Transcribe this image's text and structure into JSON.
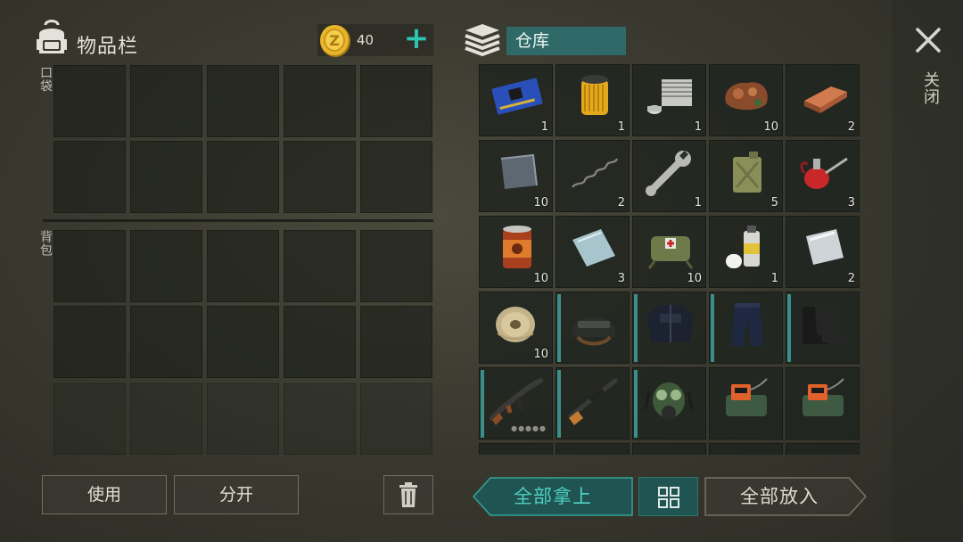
{
  "inventory": {
    "title": "物品栏",
    "pocket_label": "口袋",
    "backpack_label": "背包",
    "coins": "40"
  },
  "storage": {
    "title": "仓库",
    "close_label": "关闭",
    "items": [
      {
        "name": "circuit-board",
        "qty": "1",
        "mark": false
      },
      {
        "name": "oil-filter",
        "qty": "1",
        "mark": false
      },
      {
        "name": "engine-cylinder",
        "qty": "1",
        "mark": false
      },
      {
        "name": "copper-ore",
        "qty": "10",
        "mark": false
      },
      {
        "name": "copper-ingot",
        "qty": "2",
        "mark": false
      },
      {
        "name": "iron-plate",
        "qty": "10",
        "mark": false
      },
      {
        "name": "spring",
        "qty": "2",
        "mark": false
      },
      {
        "name": "wrench",
        "qty": "1",
        "mark": false
      },
      {
        "name": "jerry-can",
        "qty": "5",
        "mark": false
      },
      {
        "name": "oil-can",
        "qty": "3",
        "mark": false
      },
      {
        "name": "canned-food",
        "qty": "10",
        "mark": false
      },
      {
        "name": "glass-pane",
        "qty": "3",
        "mark": false
      },
      {
        "name": "first-aid-bag",
        "qty": "10",
        "mark": false
      },
      {
        "name": "spray-paint",
        "qty": "1",
        "mark": false
      },
      {
        "name": "steel-sheet",
        "qty": "2",
        "mark": false
      },
      {
        "name": "wire-spool",
        "qty": "10",
        "mark": false
      },
      {
        "name": "tactical-helmet",
        "qty": "",
        "mark": true
      },
      {
        "name": "police-jacket",
        "qty": "",
        "mark": true
      },
      {
        "name": "police-pants",
        "qty": "",
        "mark": true
      },
      {
        "name": "combat-boots",
        "qty": "",
        "mark": true
      },
      {
        "name": "assault-rifle",
        "qty": "",
        "mark": true,
        "dots": "●●●●●"
      },
      {
        "name": "sniper-rifle",
        "qty": "",
        "mark": true
      },
      {
        "name": "gas-mask",
        "qty": "",
        "mark": true
      },
      {
        "name": "explosive-charge",
        "qty": "",
        "mark": false
      },
      {
        "name": "explosive-charge",
        "qty": "",
        "mark": false
      }
    ]
  },
  "buttons": {
    "use": "使用",
    "split": "分开",
    "take_all": "全部拿上",
    "put_all": "全部放入"
  },
  "colors": {
    "accent": "#2ec4b3",
    "take_all_text": "#4fd1c4",
    "storage_title_bg": "#2f6a68"
  }
}
